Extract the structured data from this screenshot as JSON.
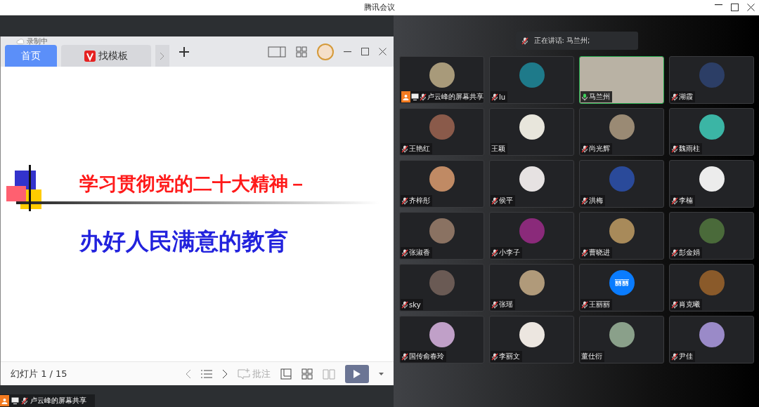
{
  "window": {
    "title": "腾讯会议"
  },
  "share": {
    "recording": "录制中",
    "tabs": [
      {
        "label": "首页",
        "selected": true,
        "kind": "home"
      },
      {
        "label": "找模板",
        "selected": false,
        "kind": "template"
      }
    ],
    "slide": {
      "title": "学习贯彻党的二十大精神－",
      "subtitle": "办好人民满意的教育"
    },
    "toolbar": {
      "counter": "幻灯片 1 / 15",
      "annotate": "批注"
    },
    "label": "卢云峰的屏幕共享"
  },
  "speaking": "正在讲话: 马兰州;",
  "participants": [
    {
      "name": "卢云峰的屏幕共享",
      "kind": "avatar",
      "mic_shown": true,
      "muted": true,
      "host": true,
      "color": "#a89a7a"
    },
    {
      "name": "lu",
      "kind": "avatar",
      "mic_shown": true,
      "muted": true,
      "host": false,
      "color": "#1e7a8a"
    },
    {
      "name": "马兰州",
      "kind": "video",
      "mic_shown": true,
      "muted": false,
      "host": false,
      "color": "#b9b2a4"
    },
    {
      "name": "湖霞",
      "kind": "avatar",
      "mic_shown": true,
      "muted": true,
      "host": false,
      "color": "#2c3e66"
    },
    {
      "name": "王艳红",
      "kind": "avatar",
      "mic_shown": true,
      "muted": true,
      "host": false,
      "color": "#8a5a4a"
    },
    {
      "name": "王颖",
      "kind": "avatar",
      "mic_shown": false,
      "host": false,
      "color": "#e8e6dc"
    },
    {
      "name": "尚光辉",
      "kind": "avatar",
      "mic_shown": true,
      "muted": true,
      "host": false,
      "color": "#9a8a74"
    },
    {
      "name": "魏雨柱",
      "kind": "avatar",
      "mic_shown": true,
      "muted": true,
      "host": false,
      "color": "#3bb5a5"
    },
    {
      "name": "齐梓彤",
      "kind": "avatar",
      "mic_shown": true,
      "muted": true,
      "host": false,
      "color": "#c08a64"
    },
    {
      "name": "侯平",
      "kind": "avatar",
      "mic_shown": true,
      "muted": true,
      "host": false,
      "color": "#e6e2e2"
    },
    {
      "name": "洪梅",
      "kind": "avatar",
      "mic_shown": true,
      "muted": true,
      "host": false,
      "color": "#2a4a9a"
    },
    {
      "name": "李楠",
      "kind": "avatar",
      "mic_shown": true,
      "muted": true,
      "host": false,
      "color": "#ececec"
    },
    {
      "name": "张淑香",
      "kind": "avatar",
      "mic_shown": true,
      "muted": true,
      "host": false,
      "color": "#8a7262"
    },
    {
      "name": "小李子",
      "kind": "avatar",
      "mic_shown": true,
      "muted": true,
      "host": false,
      "color": "#8a2a7a"
    },
    {
      "name": "曹晓进",
      "kind": "avatar",
      "mic_shown": true,
      "muted": true,
      "host": false,
      "color": "#a88a5a"
    },
    {
      "name": "彭金娟",
      "kind": "avatar",
      "mic_shown": true,
      "muted": true,
      "host": false,
      "color": "#4a6a3a"
    },
    {
      "name": "sky",
      "kind": "avatar",
      "mic_shown": true,
      "muted": true,
      "host": false,
      "color": "#6a5a54"
    },
    {
      "name": "张瑶",
      "kind": "avatar",
      "mic_shown": true,
      "muted": true,
      "host": false,
      "color": "#b09a7a"
    },
    {
      "name": "王丽丽",
      "kind": "avatar",
      "mic_shown": true,
      "muted": true,
      "host": false,
      "color": "#0a7cff",
      "avatar_text": "丽丽"
    },
    {
      "name": "肖克曦",
      "kind": "avatar",
      "mic_shown": true,
      "muted": true,
      "host": false,
      "color": "#8a5a2a"
    },
    {
      "name": "国传俞春玲",
      "kind": "avatar",
      "mic_shown": true,
      "muted": true,
      "host": false,
      "color": "#c0a0c8"
    },
    {
      "name": "李丽文",
      "kind": "avatar",
      "mic_shown": true,
      "muted": true,
      "host": false,
      "color": "#ece6e0"
    },
    {
      "name": "董仕衍",
      "kind": "avatar",
      "mic_shown": false,
      "host": false,
      "color": "#8aa08a"
    },
    {
      "name": "尹佳",
      "kind": "avatar",
      "mic_shown": true,
      "muted": true,
      "host": false,
      "color": "#9a8ac8"
    }
  ]
}
